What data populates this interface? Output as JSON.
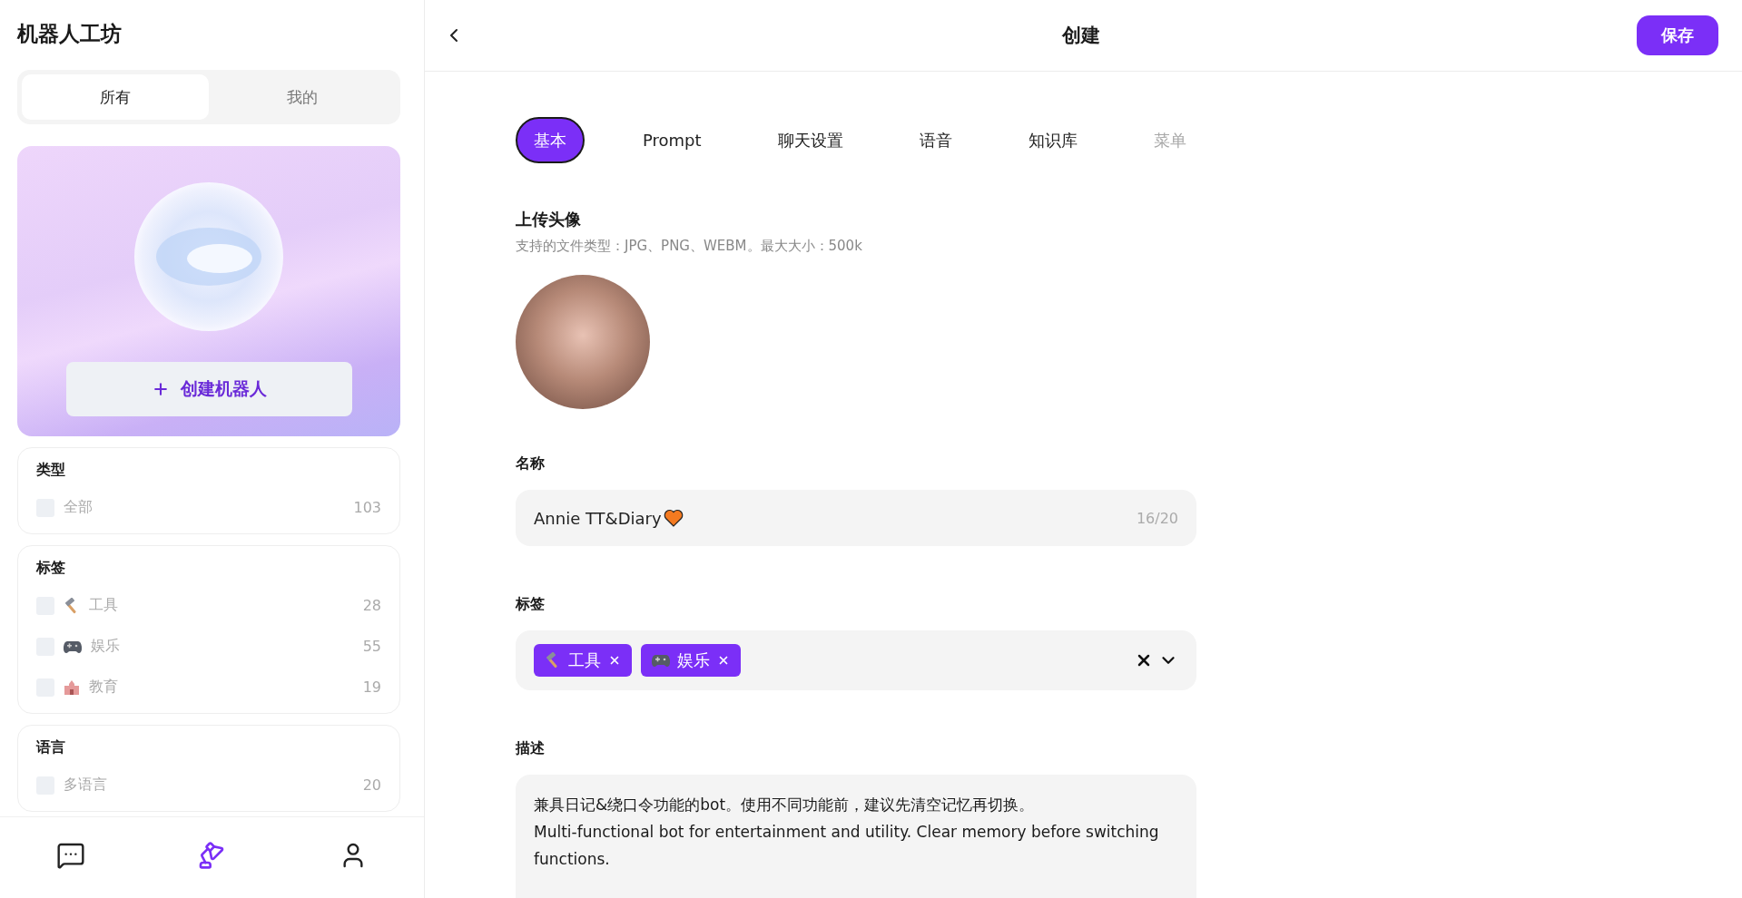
{
  "sidebar": {
    "title": "机器人工坊",
    "scope_tabs": [
      {
        "label": "所有",
        "selected": true
      },
      {
        "label": "我的",
        "selected": false
      }
    ],
    "create_button": "创建机器人",
    "filters": [
      {
        "title": "类型",
        "options": [
          {
            "kind": "plain",
            "label": "全部",
            "count": "103",
            "checked": false
          }
        ]
      },
      {
        "title": "标签",
        "options": [
          {
            "kind": "hammer",
            "label": "工具",
            "count": "28",
            "checked": false
          },
          {
            "kind": "gamepad",
            "label": "娱乐",
            "count": "55",
            "checked": false
          },
          {
            "kind": "school",
            "label": "教育",
            "count": "19",
            "checked": false
          }
        ]
      },
      {
        "title": "语言",
        "options": [
          {
            "kind": "plain",
            "label": "多语言",
            "count": "20",
            "checked": false
          }
        ]
      }
    ],
    "nav": [
      {
        "kind": "chat",
        "selected": false
      },
      {
        "kind": "lamp",
        "selected": true
      },
      {
        "kind": "user",
        "selected": false
      }
    ]
  },
  "header": {
    "title": "创建",
    "save_button": "保存"
  },
  "tabs": [
    {
      "label": "基本",
      "selected": true,
      "disabled": false
    },
    {
      "label": "Prompt",
      "selected": false,
      "disabled": false
    },
    {
      "label": "聊天设置",
      "selected": false,
      "disabled": false
    },
    {
      "label": "语音",
      "selected": false,
      "disabled": false
    },
    {
      "label": "知识库",
      "selected": false,
      "disabled": false
    },
    {
      "label": "菜单",
      "selected": false,
      "disabled": true
    }
  ],
  "form": {
    "avatar": {
      "label": "上传头像",
      "note": "支持的文件类型：JPG、PNG、WEBM。最大大小：500k"
    },
    "name": {
      "label": "名称",
      "value": "Annie TT&Diary",
      "counter": "16/20"
    },
    "tags": {
      "label": "标签",
      "items": [
        {
          "kind": "hammer",
          "label": "工具"
        },
        {
          "kind": "gamepad",
          "label": "娱乐"
        }
      ]
    },
    "description": {
      "label": "描述",
      "value": "兼具日记&绕口令功能的bot。使用不同功能前，建议先清空记忆再切换。\nMulti-functional bot for entertainment and utility. Clear memory before switching functions."
    }
  }
}
